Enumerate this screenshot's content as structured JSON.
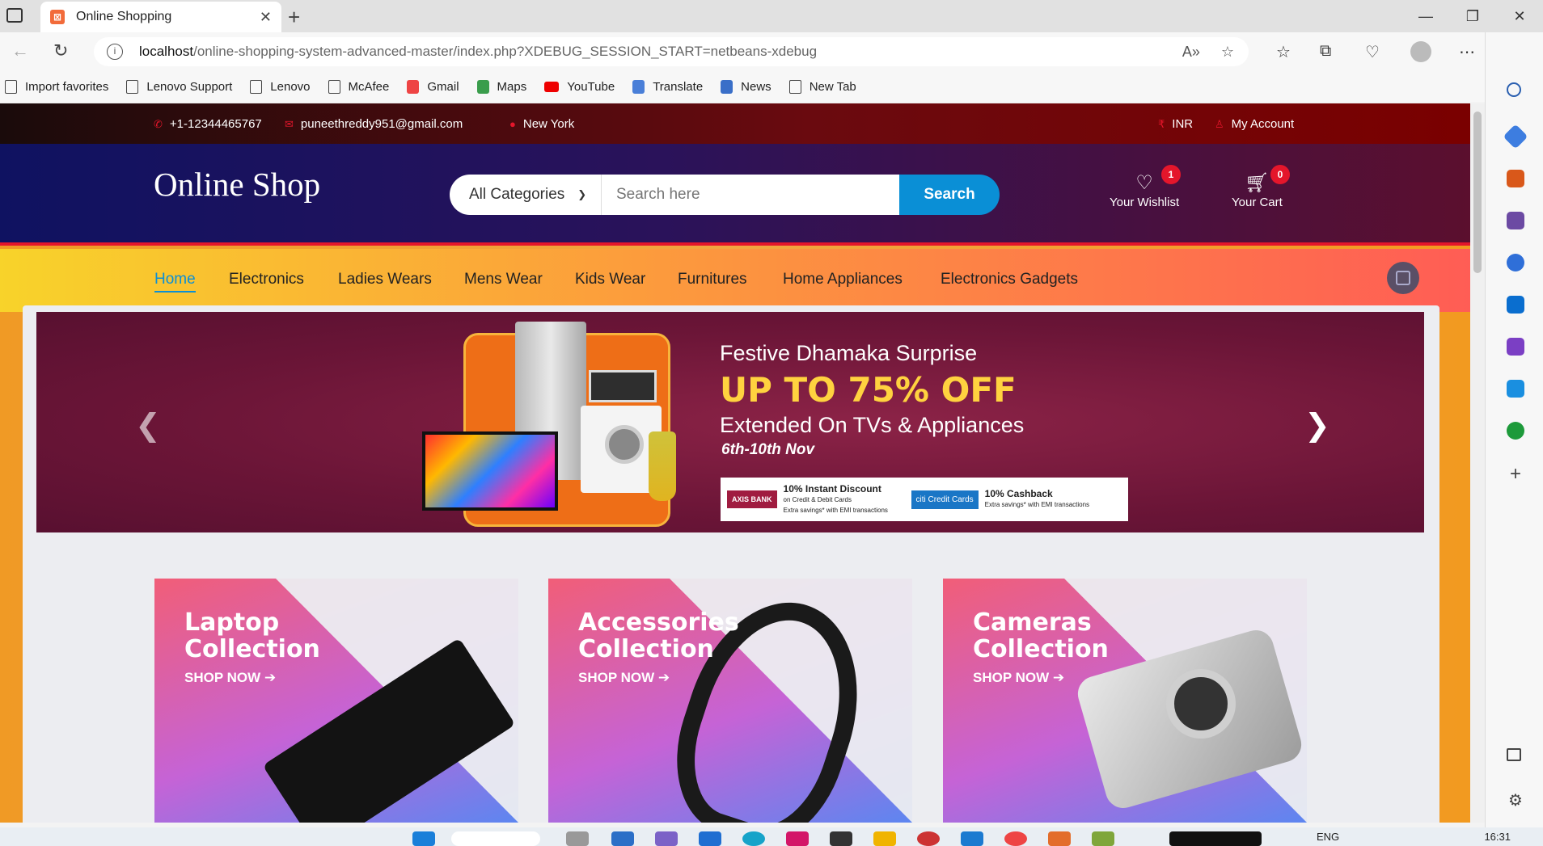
{
  "browser": {
    "tab_title": "Online Shopping",
    "url_host": "localhost",
    "url_path": "/online-shopping-system-advanced-master/index.php?XDEBUG_SESSION_START=netbeans-xdebug",
    "favorites": [
      "Import favorites",
      "Lenovo Support",
      "Lenovo",
      "McAfee",
      "Gmail",
      "Maps",
      "YouTube",
      "Translate",
      "News",
      "New Tab"
    ]
  },
  "topbar": {
    "phone": "+1-12344465767",
    "email": "puneethreddy951@gmail.com",
    "location": "New York",
    "currency": "INR",
    "account": "My Account"
  },
  "header": {
    "logo": "Online Shop",
    "category_selected": "All Categories",
    "search_placeholder": "Search here",
    "search_button": "Search",
    "wishlist_label": "Your Wishlist",
    "wishlist_count": "1",
    "cart_label": "Your Cart",
    "cart_count": "0"
  },
  "nav": [
    "Home",
    "Electronics",
    "Ladies Wears",
    "Mens Wear",
    "Kids Wear",
    "Furnitures",
    "Home Appliances",
    "Electronics Gadgets"
  ],
  "banner": {
    "title": "Festive Dhamaka Surprise",
    "headline": "UP TO 75% OFF",
    "subtitle": "Extended On TVs & Appliances",
    "dates": "6th-10th Nov",
    "offer1_bank": "AXIS BANK",
    "offer1_title": "10% Instant Discount",
    "offer1_detail": "on Credit & Debit Cards",
    "offer1_note": "Extra savings* with EMI transactions",
    "offer2_bank": "citi Credit Cards",
    "offer2_title": "10% Cashback",
    "offer2_note": "Extra savings* with EMI transactions"
  },
  "collections": [
    {
      "line1": "Laptop",
      "line2": "Collection",
      "link": "SHOP NOW"
    },
    {
      "line1": "Accessories",
      "line2": "Collection",
      "link": "SHOP NOW"
    },
    {
      "line1": "Cameras",
      "line2": "Collection",
      "link": "SHOP NOW"
    }
  ],
  "taskbar": {
    "lang": "ENG",
    "time": "16:31"
  }
}
